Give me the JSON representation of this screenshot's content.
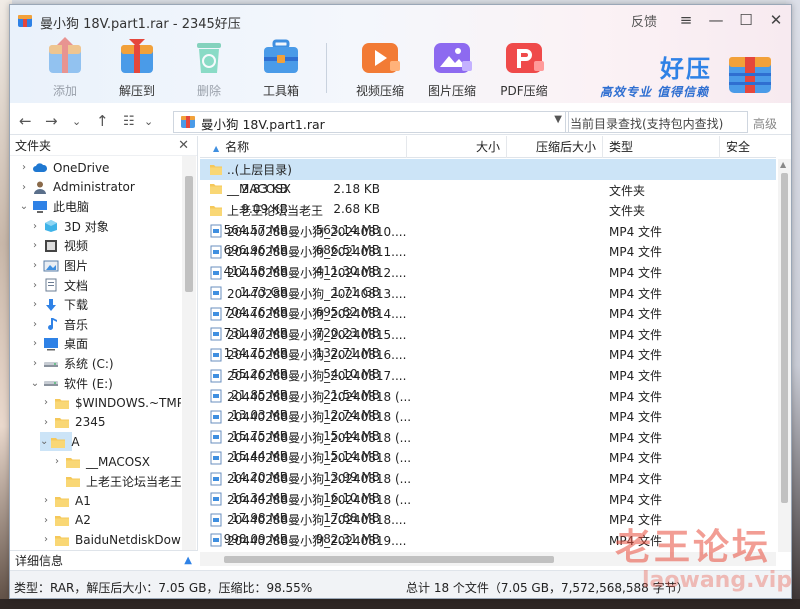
{
  "window": {
    "title": "曼小狗 18V.part1.rar - 2345好压",
    "feedback_label": "反馈",
    "menu_glyph": "≡",
    "min_glyph": "—",
    "max_glyph": "☐",
    "close_glyph": "✕"
  },
  "toolbar": {
    "tools": [
      {
        "label": "添加",
        "icon": "add-icon",
        "enabled": false
      },
      {
        "label": "解压到",
        "icon": "extract-icon",
        "enabled": true
      },
      {
        "label": "删除",
        "icon": "delete-icon",
        "enabled": false
      },
      {
        "label": "工具箱",
        "icon": "toolbox-icon",
        "enabled": true
      },
      {
        "label": "视频压缩",
        "icon": "video-compress-icon",
        "enabled": true
      },
      {
        "label": "图片压缩",
        "icon": "image-compress-icon",
        "enabled": true
      },
      {
        "label": "PDF压缩",
        "icon": "pdf-compress-icon",
        "enabled": true
      }
    ]
  },
  "brand": {
    "title": "好压",
    "slogan": "高效专业 值得信赖"
  },
  "address": {
    "path": "曼小狗 18V.part1.rar",
    "search_placeholder": "当前目录查找(支持包内查找)",
    "advanced_label": "高级"
  },
  "sidebar": {
    "header": "文件夹",
    "close_glyph": "✕",
    "footer": "详细信息",
    "items": [
      {
        "label": "OneDrive",
        "icon": "cloud-icon",
        "indent": 0,
        "arrow": "›"
      },
      {
        "label": "Administrator",
        "icon": "user-icon",
        "indent": 0,
        "arrow": "›"
      },
      {
        "label": "此电脑",
        "icon": "computer-icon",
        "indent": 0,
        "arrow": "⌄"
      },
      {
        "label": "3D 对象",
        "icon": "cube-icon",
        "indent": 1,
        "arrow": "›"
      },
      {
        "label": "视频",
        "icon": "video-folder-icon",
        "indent": 1,
        "arrow": "›"
      },
      {
        "label": "图片",
        "icon": "picture-folder-icon",
        "indent": 1,
        "arrow": "›"
      },
      {
        "label": "文档",
        "icon": "document-folder-icon",
        "indent": 1,
        "arrow": "›"
      },
      {
        "label": "下载",
        "icon": "download-icon",
        "indent": 1,
        "arrow": "›"
      },
      {
        "label": "音乐",
        "icon": "music-icon",
        "indent": 1,
        "arrow": "›"
      },
      {
        "label": "桌面",
        "icon": "desktop-icon",
        "indent": 1,
        "arrow": "›"
      },
      {
        "label": "系统 (C:)",
        "icon": "drive-icon",
        "indent": 1,
        "arrow": "›"
      },
      {
        "label": "软件 (E:)",
        "icon": "drive-icon",
        "indent": 1,
        "arrow": "⌄"
      },
      {
        "label": "$WINDOWS.~TMP",
        "icon": "folder-icon",
        "indent": 2,
        "arrow": "›"
      },
      {
        "label": "2345",
        "icon": "folder-icon",
        "indent": 2,
        "arrow": "›"
      },
      {
        "label": "A",
        "icon": "folder-icon",
        "indent": 2,
        "arrow": "⌄",
        "selected": true
      },
      {
        "label": "__MACOSX",
        "icon": "folder-icon",
        "indent": 3,
        "arrow": "›"
      },
      {
        "label": "上老王论坛当老王",
        "icon": "folder-icon",
        "indent": 3,
        "arrow": ""
      },
      {
        "label": "A1",
        "icon": "folder-icon",
        "indent": 2,
        "arrow": "›"
      },
      {
        "label": "A2",
        "icon": "folder-icon",
        "indent": 2,
        "arrow": "›"
      },
      {
        "label": "BaiduNetdiskDownl",
        "icon": "folder-icon",
        "indent": 2,
        "arrow": "›"
      }
    ]
  },
  "list": {
    "columns": {
      "name": "名称",
      "size": "大小",
      "packed": "压缩后大小",
      "type": "类型",
      "security": "安全"
    },
    "sort_glyph": "▲",
    "rows": [
      {
        "name": "..(上层目录)",
        "size": "",
        "packed": "",
        "type": "",
        "kind": "folder",
        "selected": true
      },
      {
        "name": "__MACOSX",
        "size": "2.83 KB",
        "packed": "2.18 KB",
        "type": "文件夹",
        "kind": "folder"
      },
      {
        "name": "上老王论坛当老王",
        "size": "9.09 KB",
        "packed": "2.68 KB",
        "type": "文件夹",
        "kind": "folder"
      },
      {
        "name": "20440288曼小狗_20240810....",
        "size": "564.57 MB",
        "packed": "563.14 MB",
        "type": "MP4 文件",
        "kind": "video"
      },
      {
        "name": "20440288曼小狗_20240811....",
        "size": "696.96 MB",
        "packed": "686.51 MB",
        "type": "MP4 文件",
        "kind": "video"
      },
      {
        "name": "20440288曼小狗_20240812....",
        "size": "417.58 MB",
        "packed": "411.30 MB",
        "type": "MP4 文件",
        "kind": "video"
      },
      {
        "name": "20440288曼小狗_20240813....",
        "size": "1.73 GB",
        "packed": "1.71 GB",
        "type": "MP4 文件",
        "kind": "video"
      },
      {
        "name": "20440288曼小狗_20240814....",
        "size": "704.76 MB",
        "packed": "695.82 MB",
        "type": "MP4 文件",
        "kind": "video"
      },
      {
        "name": "20440288曼小狗_20240815....",
        "size": "731.97 MB",
        "packed": "720.23 MB",
        "type": "MP4 文件",
        "kind": "video"
      },
      {
        "name": "20440288曼小狗_20240816....",
        "size": "134.75 MB",
        "packed": "132.71 MB",
        "type": "MP4 文件",
        "kind": "video"
      },
      {
        "name": "20440288曼小狗_20240817....",
        "size": "55.26 MB",
        "packed": "54.10 MB",
        "type": "MP4 文件",
        "kind": "video"
      },
      {
        "name": "20440288曼小狗_20240818 (...",
        "size": "21.85 MB",
        "packed": "21.54 MB",
        "type": "MP4 文件",
        "kind": "video"
      },
      {
        "name": "20440288曼小狗_20240818 (...",
        "size": "13.03 MB",
        "packed": "12.74 MB",
        "type": "MP4 文件",
        "kind": "video"
      },
      {
        "name": "20440288曼小狗_20240818 (...",
        "size": "15.75 MB",
        "packed": "15.44 MB",
        "type": "MP4 文件",
        "kind": "video"
      },
      {
        "name": "20440288曼小狗_20240818 (...",
        "size": "15.44 MB",
        "packed": "15.14 MB",
        "type": "MP4 文件",
        "kind": "video"
      },
      {
        "name": "20440288曼小狗_20240818 (...",
        "size": "14.20 MB",
        "packed": "13.99 MB",
        "type": "MP4 文件",
        "kind": "video"
      },
      {
        "name": "20440288曼小狗_20240818 (...",
        "size": "16.34 MB",
        "packed": "16.10 MB",
        "type": "MP4 文件",
        "kind": "video"
      },
      {
        "name": "20440288曼小狗_20240818....",
        "size": "17.98 MB",
        "packed": "17.88 MB",
        "type": "MP4 文件",
        "kind": "video"
      },
      {
        "name": "20440288曼小狗_20240819....",
        "size": "998.09 MB",
        "packed": "982.31 MB",
        "type": "MP4 文件",
        "kind": "video"
      }
    ]
  },
  "status": {
    "left": "类型：RAR，解压后大小：7.05 GB，压缩比：98.55%",
    "right": "总计 18 个文件（7.05 GB，7,572,568,588 字节）"
  },
  "watermark": {
    "line1": "老王论坛",
    "line2": "laowang.vip"
  },
  "colors": {
    "accent": "#2f82e6",
    "selection": "#cce4f7",
    "folder": "#f5c85a",
    "watermark": "#e74c3c"
  }
}
